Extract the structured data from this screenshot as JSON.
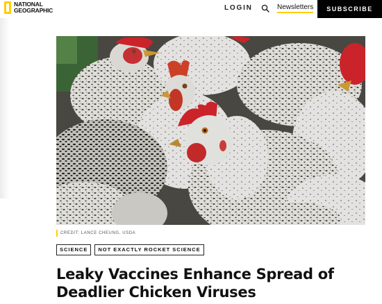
{
  "header": {
    "logo_line1": "NATIONAL",
    "logo_line2": "GEOGRAPHIC",
    "login_label": "LOGIN",
    "search_icon": "search-icon",
    "newsletters_label": "Newsletters",
    "subscribe_label": "SUBSCRIBE"
  },
  "colors": {
    "brand_yellow": "#ffce00",
    "subscribe_bg": "#000000",
    "text_dark": "#111111"
  },
  "hero": {
    "credit": "CREDIT: LANCE CHEUNG, USDA"
  },
  "article": {
    "tags": [
      "SCIENCE",
      "NOT EXACTLY ROCKET SCIENCE"
    ],
    "title": "Leaky Vaccines Enhance Spread of Deadlier Chicken Viruses"
  }
}
